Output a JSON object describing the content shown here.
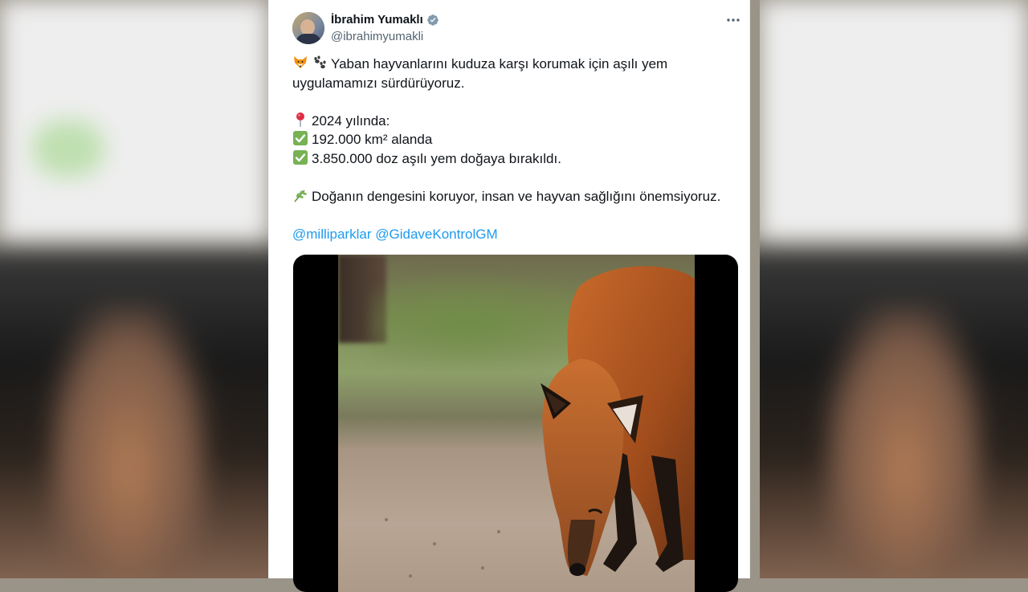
{
  "author": {
    "name": "İbrahim Yumaklı",
    "handle": "@ibrahimyumakli",
    "verified": true
  },
  "more_icon": "more-horizontal-icon",
  "tweet": {
    "line1": "Yaban hayvanlarını kuduza karşı korumak için aşılı yem",
    "line2": "uygulamamızı sürdürüyoruz.",
    "line3": "2024 yılında:",
    "line4": "192.000 km² alanda",
    "line5": "3.850.000 doz aşılı yem doğaya bırakıldı.",
    "line6": "Doğanın dengesini koruyor, insan ve hayvan sağlığını önemsiyoruz.",
    "mention1": "@milliparklar",
    "mention2": "@GidaveKontrolGM"
  },
  "icons": {
    "fox": "fox-emoji-icon",
    "paws": "paw-prints-emoji-icon",
    "pin": "round-pushpin-emoji-icon",
    "check": "check-mark-button-emoji-icon",
    "herb": "herb-emoji-icon"
  },
  "colors": {
    "link": "#1d9bf0",
    "verified": "#829aab",
    "text": "#0f1419",
    "secondary": "#536471"
  },
  "media": {
    "type": "video",
    "subject": "red fox sniffing ground"
  }
}
